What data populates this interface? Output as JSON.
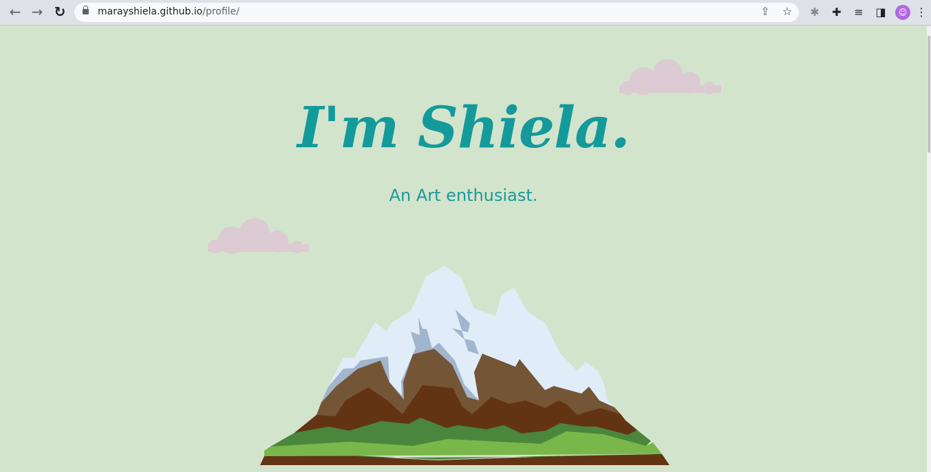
{
  "browser": {
    "url_host": "marayshiela.github.io",
    "url_path": "/profile/",
    "icons": [
      "back-arrow-icon",
      "forward-arrow-icon",
      "reload-icon",
      "lock-icon",
      "share-icon",
      "star-icon",
      "bug-extension-icon",
      "puzzle-extensions-icon",
      "media-playlist-icon",
      "side-panel-icon",
      "profile-avatar-icon",
      "more-menu-icon"
    ]
  },
  "hero": {
    "title": "I'm Shiela.",
    "subtitle": "An Art enthusiast."
  },
  "colors": {
    "background": "#d3e4cc",
    "accent": "#149a9b",
    "cloud": "#dccbd3"
  }
}
